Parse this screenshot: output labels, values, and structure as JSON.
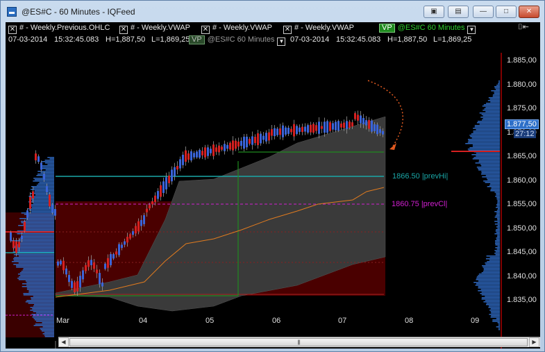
{
  "window": {
    "title": "@ES#C - 60 Minutes - IQFeed",
    "buttons": [
      "link-icon",
      "tile-icon",
      "minimize-icon",
      "maximize-icon",
      "close-icon"
    ]
  },
  "header": {
    "studies": [
      "# - Weekly.Previous.OHLC",
      "# - Weekly.VWAP",
      "# - Weekly.VWAP",
      "# - Weekly.VWAP"
    ],
    "vp_label": "VP",
    "series_label": "@ES#C  60 Minutes",
    "row2": {
      "date": "07-03-2014",
      "time": "15:32:45.083",
      "high": "H=1,887,50",
      "low": "L=1,869,25"
    },
    "vp2_series": "@ES#C  60 Minutes",
    "row2b": {
      "date": "07-03-2014",
      "time": "15:32:45.083",
      "high": "H=1,887,50",
      "low": "L=1,869,25"
    },
    "pin_icon": "pin-icon"
  },
  "price_axis": {
    "labels": [
      "1.885,00",
      "1.880,00",
      "1.875,00",
      "1.870,00",
      "1.865,00",
      "1.860,00",
      "1.855,00",
      "1.850,00",
      "1.845,00",
      "1.840,00",
      "1.835,00"
    ],
    "current_price": "1.877,50",
    "current_sub": "27:12"
  },
  "time_axis": {
    "labels": [
      "Mar",
      "04",
      "05",
      "06",
      "07",
      "08",
      "09"
    ]
  },
  "annotations": {
    "prev_high": "1866.50 |prevHi|",
    "prev_close": "1860.75 |prevCl|"
  },
  "colors": {
    "up_bar": "#3a64d8",
    "down_bar": "#d42020",
    "prev_high_line": "#1aa7a7",
    "prev_close_line": "#d21fd2",
    "vwap_line": "#e07b1f",
    "band_fill": "#3a3a3a",
    "value_area": "#4a0000",
    "poc_line": "#1f8a1f"
  },
  "chart_data": {
    "type": "candlestick",
    "ylim": [
      1833,
      1888
    ],
    "x": [
      "Mar",
      "04",
      "05",
      "06",
      "07"
    ],
    "prev_high": 1866.5,
    "prev_close": 1860.75,
    "last": 1877.5,
    "high": 1887.5,
    "low": 1869.25
  }
}
